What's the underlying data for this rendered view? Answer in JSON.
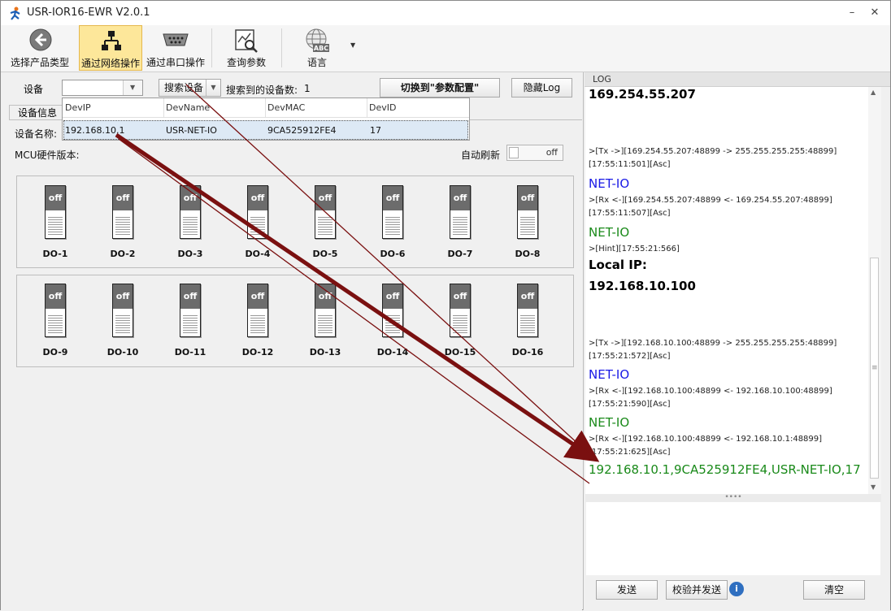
{
  "window": {
    "title": "USR-IOR16-EWR V2.0.1"
  },
  "toolbar": {
    "items": [
      {
        "label": "选择产品类型",
        "icon": "back-arrow-icon"
      },
      {
        "label": "通过网络操作",
        "icon": "network-icon",
        "active": true
      },
      {
        "label": "通过串口操作",
        "icon": "serial-port-icon"
      },
      {
        "label": "查询参数",
        "icon": "query-chart-icon"
      },
      {
        "label": "语言",
        "icon": "globe-abc-icon"
      }
    ]
  },
  "device": {
    "label": "设备",
    "combo_value": "",
    "search_button": "搜索设备",
    "found_label": "搜索到的设备数:",
    "found_count": "1",
    "switch_button": "切换到\"参数配置\"",
    "hide_log_button": "隐藏Log"
  },
  "tab": {
    "label": "设备信息"
  },
  "dropdown": {
    "columns": [
      "DevIP",
      "DevName",
      "DevMAC",
      "DevID"
    ],
    "rows": [
      [
        "192.168.10.1",
        "USR-NET-IO",
        "9CA525912FE4",
        "17"
      ]
    ]
  },
  "info": {
    "name_label": "设备名称:",
    "mcu_label": "MCU硬件版本:",
    "auto_refresh_label": "自动刷新",
    "auto_refresh_state": "off"
  },
  "outputs": {
    "state_text": "off",
    "labels": [
      "DO-1",
      "DO-2",
      "DO-3",
      "DO-4",
      "DO-5",
      "DO-6",
      "DO-7",
      "DO-8",
      "DO-9",
      "DO-10",
      "DO-11",
      "DO-12",
      "DO-13",
      "DO-14",
      "DO-15",
      "DO-16"
    ]
  },
  "log": {
    "header": "LOG",
    "lines": [
      {
        "text": "169.254.55.207",
        "style": "big"
      },
      {
        "text": ">[Tx ->][169.254.55.207:48899 -> 255.255.255.255:48899]",
        "style": "small"
      },
      {
        "text": "[17:55:11:501][Asc]",
        "style": "small"
      },
      {
        "text": "NET-IO",
        "style": "blue"
      },
      {
        "text": ">[Rx <-][169.254.55.207:48899 <- 169.254.55.207:48899]",
        "style": "small"
      },
      {
        "text": "[17:55:11:507][Asc]",
        "style": "small"
      },
      {
        "text": "NET-IO",
        "style": "green"
      },
      {
        "text": ">[Hint][17:55:21:566]",
        "style": "small"
      },
      {
        "text": "Local IP:",
        "style": "big"
      },
      {
        "text": "192.168.10.100",
        "style": "big"
      },
      {
        "text": ">[Tx ->][192.168.10.100:48899 -> 255.255.255.255:48899]",
        "style": "small"
      },
      {
        "text": "[17:55:21:572][Asc]",
        "style": "small"
      },
      {
        "text": "NET-IO",
        "style": "blue"
      },
      {
        "text": ">[Rx <-][192.168.10.100:48899 <- 192.168.10.100:48899]",
        "style": "small"
      },
      {
        "text": "[17:55:21:590][Asc]",
        "style": "small"
      },
      {
        "text": "NET-IO",
        "style": "green"
      },
      {
        "text": ">[Rx <-][192.168.10.100:48899 <- 192.168.10.1:48899]",
        "style": "small"
      },
      {
        "text": "[17:55:21:625][Asc]",
        "style": "small"
      },
      {
        "text": "192.168.10.1,9CA525912FE4,USR-NET-IO,17",
        "style": "green"
      }
    ]
  },
  "bottom": {
    "send": "发送",
    "check_send": "校验并发送",
    "info": "i",
    "clear": "清空"
  }
}
